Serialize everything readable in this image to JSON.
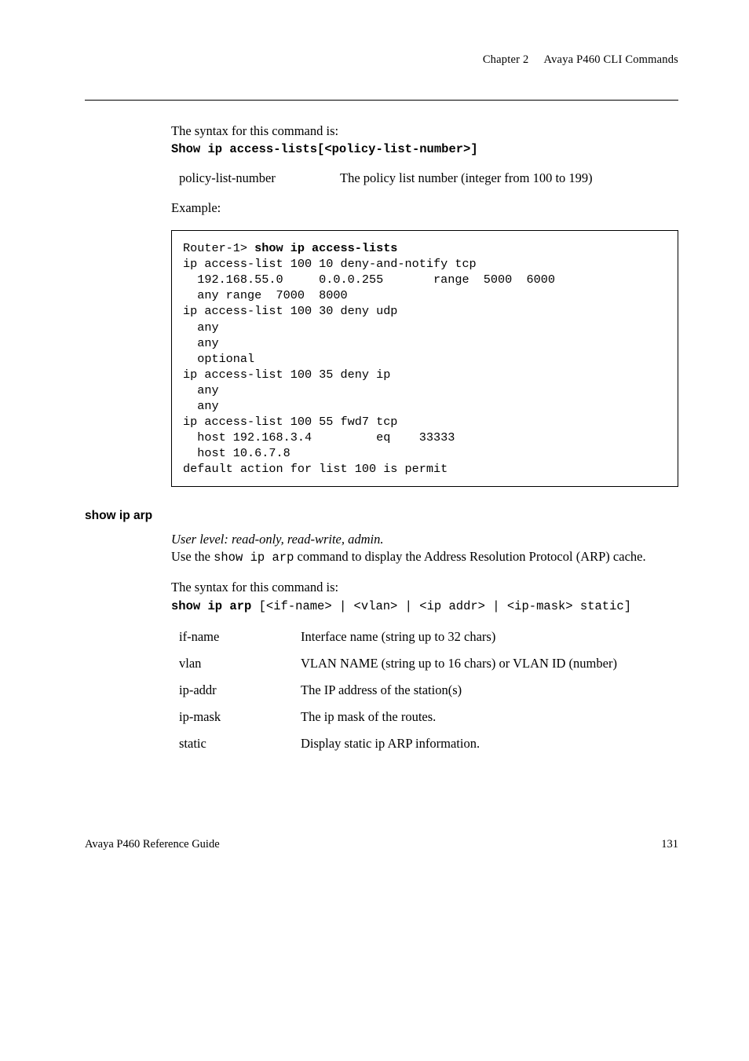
{
  "header": {
    "chapter_label": "Chapter 2",
    "chapter_title": "Avaya P460 CLI Commands"
  },
  "section1": {
    "intro": "The syntax for this command is:",
    "command": "Show ip access-lists[<policy-list-number>]",
    "param_name": "policy-list-number",
    "param_desc": "The policy list number (integer from 100 to 199)",
    "example_label": "Example:",
    "code_prompt": "Router-1> ",
    "code_cmd": "show ip access-lists",
    "code_body": "ip access-list 100 10 deny-and-notify tcp\n  192.168.55.0     0.0.0.255       range  5000  6000\n  any range  7000  8000\nip access-list 100 30 deny udp\n  any\n  any\n  optional\nip access-list 100 35 deny ip\n  any\n  any\nip access-list 100 55 fwd7 tcp\n  host 192.168.3.4         eq    33333\n  host 10.6.7.8\ndefault action for list 100 is permit"
  },
  "section2": {
    "heading": "show ip arp",
    "userlevel": "User level: read-only, read-write, admin.",
    "desc_1": "Use the ",
    "desc_code": "show ip arp",
    "desc_2": " command to display the Address Resolution Protocol (ARP) cache.",
    "syntax_intro": "The syntax for this command is:",
    "syntax_cmd_bold": "show ip arp",
    "syntax_cmd_rest": " [<if-name> | <vlan> | <ip addr> | <ip-mask> static]",
    "params": [
      {
        "name": "if-name",
        "desc": "Interface name (string up to 32 chars)"
      },
      {
        "name": "vlan",
        "desc": "VLAN NAME (string up to 16 chars) or VLAN ID (number)"
      },
      {
        "name": "ip-addr",
        "desc": "The IP address of the station(s)"
      },
      {
        "name": "ip-mask",
        "desc": "The ip mask of the routes."
      },
      {
        "name": "static",
        "desc": "Display static ip ARP information."
      }
    ]
  },
  "footer": {
    "left": "Avaya P460 Reference Guide",
    "right": "131"
  }
}
